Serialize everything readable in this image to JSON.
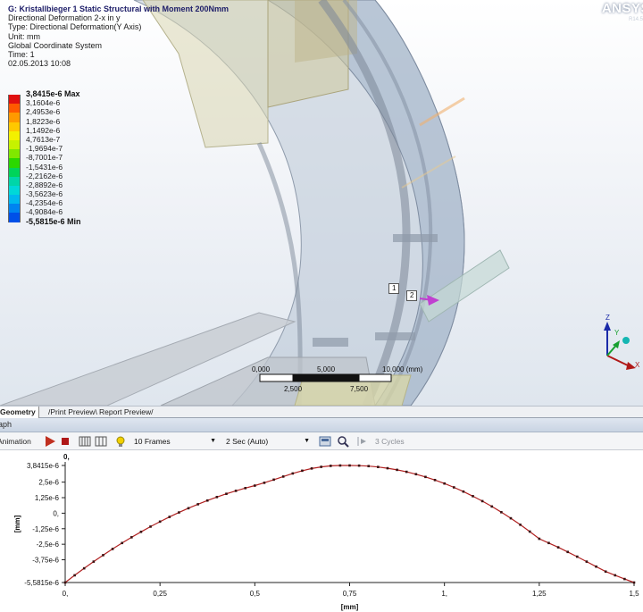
{
  "result_info": {
    "title": "G: Kristallbieger 1 Static Structural with Moment 200Nmm",
    "lines": [
      "Directional Deformation 2-x in y",
      "Type: Directional Deformation(Y Axis)",
      "Unit: mm",
      "Global Coordinate System",
      "Time: 1",
      "02.05.2013 10:08"
    ]
  },
  "legend": {
    "entries": [
      {
        "label": "3,8415e-6 Max",
        "color": "#e01010",
        "bold": true
      },
      {
        "label": "3,1604e-6",
        "color": "#ff5a00",
        "bold": false
      },
      {
        "label": "2,4953e-6",
        "color": "#ff9a00",
        "bold": false
      },
      {
        "label": "1,8223e-6",
        "color": "#ffc800",
        "bold": false
      },
      {
        "label": "1,1492e-6",
        "color": "#f3f000",
        "bold": false
      },
      {
        "label": "4,7613e-7",
        "color": "#c6f200",
        "bold": false
      },
      {
        "label": "-1,9694e-7",
        "color": "#80e800",
        "bold": false
      },
      {
        "label": "-8,7001e-7",
        "color": "#2bd800",
        "bold": false
      },
      {
        "label": "-1,5431e-6",
        "color": "#00d45a",
        "bold": false
      },
      {
        "label": "-2,2162e-6",
        "color": "#00d6a8",
        "bold": false
      },
      {
        "label": "-2,8892e-6",
        "color": "#00d8d8",
        "bold": false
      },
      {
        "label": "-3,5623e-6",
        "color": "#00b8ee",
        "bold": false
      },
      {
        "label": "-4,2354e-6",
        "color": "#0084f0",
        "bold": false
      },
      {
        "label": "-4,9084e-6",
        "color": "#0050e8",
        "bold": false
      },
      {
        "label": "-5,5815e-6 Min",
        "color": "#0010d0",
        "bold": true
      }
    ]
  },
  "logo": {
    "text": "ANSYS",
    "version": "R14.5"
  },
  "probes": [
    {
      "label": "1"
    },
    {
      "label": "2"
    }
  ],
  "axis_triad": {
    "z": "Z",
    "y": "Y",
    "x": "X"
  },
  "scale_bar": {
    "top_labels": [
      "0,000",
      "5,000",
      "10,000 (mm)"
    ],
    "bottom_labels": [
      "2,500",
      "7,500"
    ]
  },
  "tabs": [
    "Geometry",
    "Print Preview",
    "Report Preview"
  ],
  "graph_panel": {
    "title": "aph"
  },
  "animation_toolbar": {
    "label": "Animation",
    "frames": "10 Frames",
    "duration": "2 Sec (Auto)",
    "cycles": "3 Cycles"
  },
  "colors": {
    "accent": "#20206a",
    "play": "#c03020",
    "curve": "#b02020"
  },
  "chart_data": {
    "type": "line",
    "title": "0,",
    "xlabel": "[mm]",
    "ylabel": "[mm]",
    "xlim": [
      0,
      1.5
    ],
    "ylim": [
      -5.5815e-06,
      3.8415e-06
    ],
    "xticks": [
      {
        "v": 0,
        "label": "0,"
      },
      {
        "v": 0.25,
        "label": "0,25"
      },
      {
        "v": 0.5,
        "label": "0,5"
      },
      {
        "v": 0.75,
        "label": "0,75"
      },
      {
        "v": 1.0,
        "label": "1,"
      },
      {
        "v": 1.25,
        "label": "1,25"
      },
      {
        "v": 1.5,
        "label": "1,5"
      }
    ],
    "yticks": [
      {
        "v": 3.8415e-06,
        "label": "3,8415e-6"
      },
      {
        "v": 2.5e-06,
        "label": "2,5e-6"
      },
      {
        "v": 1.25e-06,
        "label": "1,25e-6"
      },
      {
        "v": 0,
        "label": "0,"
      },
      {
        "v": -1.25e-06,
        "label": "-1,25e-6"
      },
      {
        "v": -2.5e-06,
        "label": "-2,5e-6"
      },
      {
        "v": -3.75e-06,
        "label": "-3,75e-6"
      },
      {
        "v": -5.5815e-06,
        "label": "-5,5815e-6"
      }
    ],
    "grid": false,
    "series": [
      {
        "x": [
          0,
          0.025,
          0.05,
          0.075,
          0.1,
          0.125,
          0.15,
          0.175,
          0.2,
          0.225,
          0.25,
          0.275,
          0.3,
          0.325,
          0.35,
          0.375,
          0.4,
          0.425,
          0.45,
          0.475,
          0.5,
          0.525,
          0.55,
          0.575,
          0.6,
          0.625,
          0.65,
          0.675,
          0.7,
          0.725,
          0.75,
          0.775,
          0.8,
          0.825,
          0.85,
          0.875,
          0.9,
          0.925,
          0.95,
          0.975,
          1.0,
          1.025,
          1.05,
          1.075,
          1.1,
          1.125,
          1.15,
          1.175,
          1.2,
          1.225,
          1.25,
          1.275,
          1.3,
          1.325,
          1.35,
          1.375,
          1.4,
          1.425,
          1.45,
          1.475,
          1.5
        ],
        "y": [
          -5.5815e-06,
          -5e-06,
          -4.44e-06,
          -3.9e-06,
          -3.38e-06,
          -2.88e-06,
          -2.4e-06,
          -1.94e-06,
          -1.5e-06,
          -1.08e-06,
          -6.8e-07,
          -3e-07,
          6e-08,
          4e-07,
          7.2e-07,
          1.02e-06,
          1.3e-06,
          1.56e-06,
          1.8e-06,
          2.02e-06,
          2.22e-06,
          2.45e-06,
          2.7e-06,
          2.95e-06,
          3.2e-06,
          3.42e-06,
          3.6e-06,
          3.73e-06,
          3.81e-06,
          3.84e-06,
          3.8415e-06,
          3.83e-06,
          3.79e-06,
          3.72e-06,
          3.62e-06,
          3.49e-06,
          3.33e-06,
          3.14e-06,
          2.92e-06,
          2.67e-06,
          2.39e-06,
          2.08e-06,
          1.74e-06,
          1.37e-06,
          9.7e-07,
          5.4e-07,
          8e-08,
          -4.1e-07,
          -9.3e-07,
          -1.48e-06,
          -2.06e-06,
          -2.4e-06,
          -2.75e-06,
          -3.12e-06,
          -3.5e-06,
          -3.9e-06,
          -4.3e-06,
          -4.7e-06,
          -5e-06,
          -5.3e-06,
          -5.5815e-06
        ]
      }
    ]
  }
}
